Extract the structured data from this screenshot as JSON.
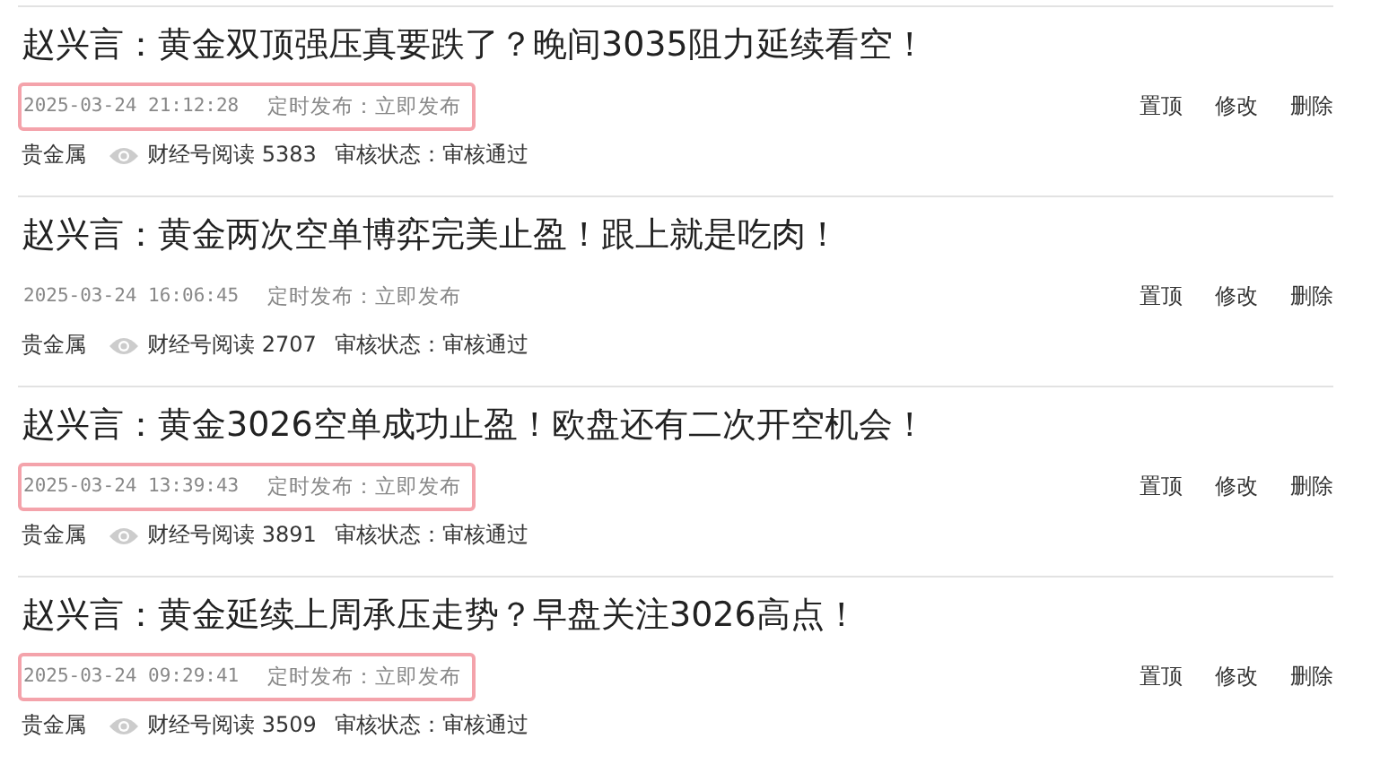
{
  "articles": [
    {
      "title": "赵兴言：黄金双顶强压真要跌了？晚间3035阻力延续看空！",
      "time": "2025-03-24 21:12:28",
      "schedule": "定时发布：立即发布",
      "highlighted": true,
      "category": "贵金属",
      "reads": "财经号阅读 5383",
      "review": "审核状态：审核通过",
      "actions": [
        "置顶",
        "修改",
        "删除"
      ]
    },
    {
      "title": "赵兴言：黄金两次空单博弈完美止盈！跟上就是吃肉！",
      "time": "2025-03-24 16:06:45",
      "schedule": "定时发布：立即发布",
      "highlighted": false,
      "category": "贵金属",
      "reads": "财经号阅读 2707",
      "review": "审核状态：审核通过",
      "actions": [
        "置顶",
        "修改",
        "删除"
      ]
    },
    {
      "title": "赵兴言：黄金3026空单成功止盈！欧盘还有二次开空机会！",
      "time": "2025-03-24 13:39:43",
      "schedule": "定时发布：立即发布",
      "highlighted": true,
      "category": "贵金属",
      "reads": "财经号阅读 3891",
      "review": "审核状态：审核通过",
      "actions": [
        "置顶",
        "修改",
        "删除"
      ]
    },
    {
      "title": "赵兴言：黄金延续上周承压走势？早盘关注3026高点！",
      "time": "2025-03-24 09:29:41",
      "schedule": "定时发布：立即发布",
      "highlighted": true,
      "category": "贵金属",
      "reads": "财经号阅读 3509",
      "review": "审核状态：审核通过",
      "actions": [
        "置顶",
        "修改",
        "删除"
      ]
    }
  ]
}
